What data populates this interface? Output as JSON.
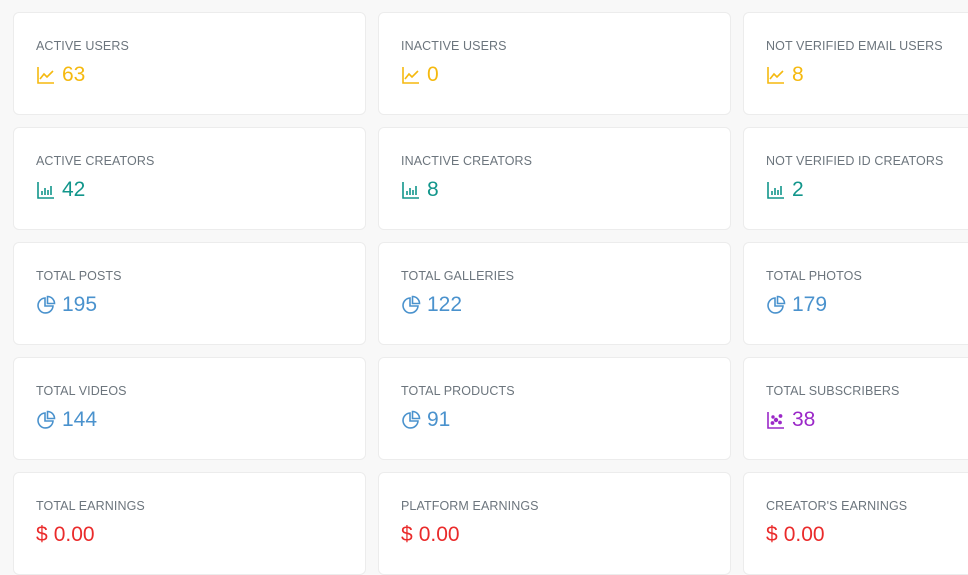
{
  "cards": [
    {
      "label": "ACTIVE USERS",
      "value": "63",
      "icon": "line-chart-icon",
      "color": "#f5b90f"
    },
    {
      "label": "INACTIVE USERS",
      "value": "0",
      "icon": "line-chart-icon",
      "color": "#f5b90f"
    },
    {
      "label": "NOT VERIFIED EMAIL USERS",
      "value": "8",
      "icon": "line-chart-icon",
      "color": "#f5b90f"
    },
    {
      "label": "ACTIVE CREATORS",
      "value": "42",
      "icon": "bar-chart-icon",
      "color": "#12968b"
    },
    {
      "label": "INACTIVE CREATORS",
      "value": "8",
      "icon": "bar-chart-icon",
      "color": "#12968b"
    },
    {
      "label": "NOT VERIFIED ID CREATORS",
      "value": "2",
      "icon": "bar-chart-icon",
      "color": "#12968b"
    },
    {
      "label": "TOTAL POSTS",
      "value": "195",
      "icon": "pie-chart-icon",
      "color": "#4a92cd"
    },
    {
      "label": "TOTAL GALLERIES",
      "value": "122",
      "icon": "pie-chart-icon",
      "color": "#4a92cd"
    },
    {
      "label": "TOTAL PHOTOS",
      "value": "179",
      "icon": "pie-chart-icon",
      "color": "#4a92cd"
    },
    {
      "label": "TOTAL VIDEOS",
      "value": "144",
      "icon": "pie-chart-icon",
      "color": "#4a92cd"
    },
    {
      "label": "TOTAL PRODUCTS",
      "value": "91",
      "icon": "pie-chart-icon",
      "color": "#4a92cd"
    },
    {
      "label": "TOTAL SUBSCRIBERS",
      "value": "38",
      "icon": "scatter-chart-icon",
      "color": "#9b28c8"
    },
    {
      "label": "TOTAL EARNINGS",
      "value": "0.00",
      "currency": "$",
      "color": "#ea2b2b"
    },
    {
      "label": "PLATFORM EARNINGS",
      "value": "0.00",
      "currency": "$",
      "color": "#ea2b2b"
    },
    {
      "label": "CREATOR'S EARNINGS",
      "value": "0.00",
      "currency": "$",
      "color": "#ea2b2b"
    }
  ]
}
